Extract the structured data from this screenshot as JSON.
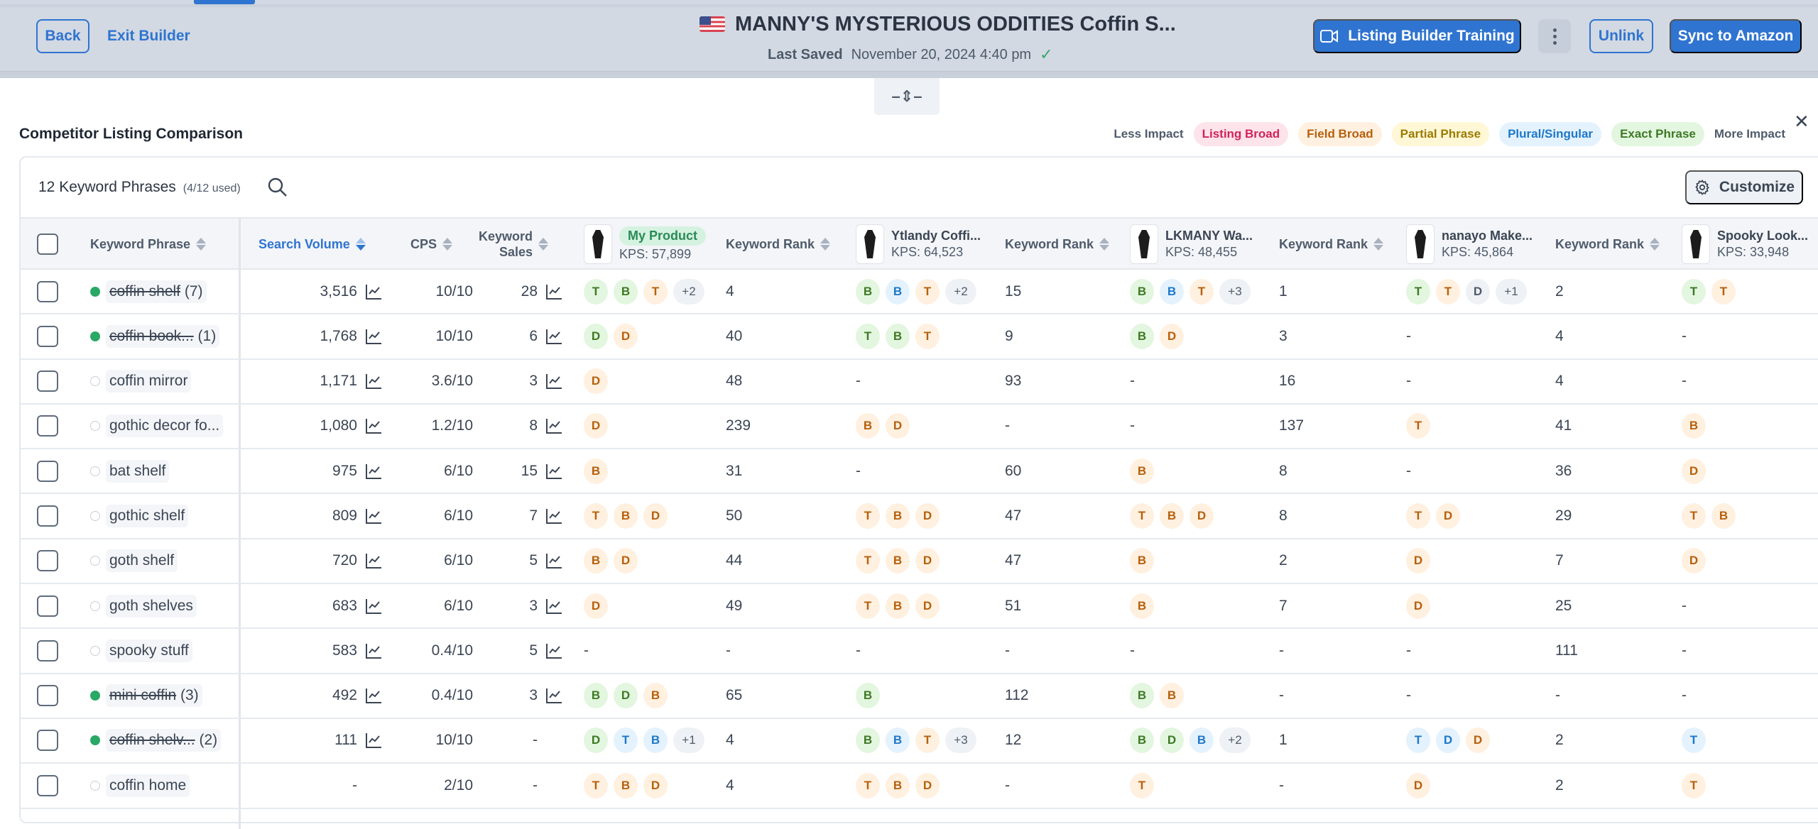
{
  "header": {
    "back_label": "Back",
    "exit_label": "Exit Builder",
    "flag_icon": "us-flag-icon",
    "title": "MANNY'S MYSTERIOUS ODDITIES Coffin S...",
    "last_saved_label": "Last Saved",
    "last_saved_value": "November 20, 2024 4:40 pm",
    "saved_icon": "check-icon",
    "training_label": "Listing Builder Training",
    "training_icon": "video-camera-icon",
    "more_icon": "kebab-menu-icon",
    "unlink_label": "Unlink",
    "sync_label": "Sync to Amazon"
  },
  "drag_handle": {
    "icon": "resize-vertical-icon",
    "glyph": "–⇕–"
  },
  "section": {
    "title": "Competitor Listing Comparison",
    "close_glyph": "✕",
    "legend": {
      "less_label": "Less Impact",
      "more_label": "More Impact",
      "items": [
        {
          "label": "Listing Broad",
          "bg": "#fde3ea",
          "color": "#d0245a"
        },
        {
          "label": "Field Broad",
          "bg": "#fff0e0",
          "color": "#b6600c"
        },
        {
          "label": "Partial Phrase",
          "bg": "#fff7d6",
          "color": "#9a7b00"
        },
        {
          "label": "Plural/Singular",
          "bg": "#e4f2fd",
          "color": "#1d78c9"
        },
        {
          "label": "Exact Phrase",
          "bg": "#e3f6df",
          "color": "#3d7a25"
        }
      ]
    }
  },
  "toolbar": {
    "count_label": "12 Keyword Phrases",
    "used_label": "(4/12 used)",
    "search_icon": "search-icon",
    "customize_label": "Customize",
    "customize_icon": "gear-icon"
  },
  "columns": {
    "keyword": "Keyword Phrase",
    "search_volume": "Search Volume",
    "cps": "CPS",
    "keyword_sales_line1": "Keyword",
    "keyword_sales_line2": "Sales",
    "rank": "Keyword Rank",
    "products": [
      {
        "name": "My Product",
        "kps": "KPS: 57,899",
        "mine": true
      },
      {
        "name": "Ytlandy Coffi...",
        "kps": "KPS: 64,523",
        "mine": false
      },
      {
        "name": "LKMANY Wa...",
        "kps": "KPS: 48,455",
        "mine": false
      },
      {
        "name": "nanayo Make...",
        "kps": "KPS: 45,864",
        "mine": false
      },
      {
        "name": "Spooky Look...",
        "kps": "KPS: 33,948",
        "mine": false
      }
    ]
  },
  "rows": [
    {
      "keyword": "coffin shelf",
      "count": "(7)",
      "used": true,
      "sv": "3,516",
      "sv_trend": true,
      "cps": "10/10",
      "ks": "28",
      "ks_trend": true,
      "products": [
        {
          "badges": [
            [
              "T",
              "exact"
            ],
            [
              "B",
              "exact"
            ],
            [
              "T",
              "field"
            ],
            [
              "+2",
              "more"
            ]
          ],
          "rank": "4"
        },
        {
          "badges": [
            [
              "B",
              "exact"
            ],
            [
              "B",
              "plural"
            ],
            [
              "T",
              "field"
            ],
            [
              "+2",
              "more"
            ]
          ],
          "rank": "15"
        },
        {
          "badges": [
            [
              "B",
              "exact"
            ],
            [
              "B",
              "plural"
            ],
            [
              "T",
              "field"
            ],
            [
              "+3",
              "more"
            ]
          ],
          "rank": "1"
        },
        {
          "badges": [
            [
              "T",
              "exact"
            ],
            [
              "T",
              "field"
            ],
            [
              "D",
              "neutral"
            ],
            [
              "+1",
              "more"
            ]
          ],
          "rank": "2"
        },
        {
          "badges": [
            [
              "T",
              "exact"
            ],
            [
              "T",
              "field"
            ]
          ],
          "rank": null
        }
      ]
    },
    {
      "keyword": "coffin book...",
      "count": "(1)",
      "used": true,
      "sv": "1,768",
      "sv_trend": true,
      "cps": "10/10",
      "ks": "6",
      "ks_trend": true,
      "products": [
        {
          "badges": [
            [
              "D",
              "exact"
            ],
            [
              "D",
              "field"
            ]
          ],
          "rank": "40"
        },
        {
          "badges": [
            [
              "T",
              "exact"
            ],
            [
              "B",
              "exact"
            ],
            [
              "T",
              "field"
            ]
          ],
          "rank": "9"
        },
        {
          "badges": [
            [
              "B",
              "exact"
            ],
            [
              "D",
              "field"
            ]
          ],
          "rank": "3"
        },
        {
          "badges": [],
          "rank": "4"
        },
        {
          "badges": [],
          "rank": null
        }
      ]
    },
    {
      "keyword": "coffin mirror",
      "count": "",
      "used": false,
      "sv": "1,171",
      "sv_trend": true,
      "cps": "3.6/10",
      "ks": "3",
      "ks_trend": true,
      "products": [
        {
          "badges": [
            [
              "D",
              "field"
            ]
          ],
          "rank": "48"
        },
        {
          "badges": [],
          "rank": "93"
        },
        {
          "badges": [],
          "rank": "16"
        },
        {
          "badges": [],
          "rank": "4"
        },
        {
          "badges": [],
          "rank": null
        }
      ]
    },
    {
      "keyword": "gothic decor fo...",
      "count": "",
      "used": false,
      "sv": "1,080",
      "sv_trend": true,
      "cps": "1.2/10",
      "ks": "8",
      "ks_trend": true,
      "products": [
        {
          "badges": [
            [
              "D",
              "field"
            ]
          ],
          "rank": "239"
        },
        {
          "badges": [
            [
              "B",
              "field"
            ],
            [
              "D",
              "field"
            ]
          ],
          "rank": "-"
        },
        {
          "badges": [],
          "rank": "137"
        },
        {
          "badges": [
            [
              "T",
              "field"
            ]
          ],
          "rank": "41"
        },
        {
          "badges": [
            [
              "B",
              "field"
            ]
          ],
          "rank": null
        }
      ]
    },
    {
      "keyword": "bat shelf",
      "count": "",
      "used": false,
      "sv": "975",
      "sv_trend": true,
      "cps": "6/10",
      "ks": "15",
      "ks_trend": true,
      "products": [
        {
          "badges": [
            [
              "B",
              "field"
            ]
          ],
          "rank": "31"
        },
        {
          "badges": [],
          "rank": "60"
        },
        {
          "badges": [
            [
              "B",
              "field"
            ]
          ],
          "rank": "8"
        },
        {
          "badges": [],
          "rank": "36"
        },
        {
          "badges": [
            [
              "D",
              "field"
            ]
          ],
          "rank": null
        }
      ]
    },
    {
      "keyword": "gothic shelf",
      "count": "",
      "used": false,
      "sv": "809",
      "sv_trend": true,
      "cps": "6/10",
      "ks": "7",
      "ks_trend": true,
      "products": [
        {
          "badges": [
            [
              "T",
              "field"
            ],
            [
              "B",
              "field"
            ],
            [
              "D",
              "field"
            ]
          ],
          "rank": "50"
        },
        {
          "badges": [
            [
              "T",
              "field"
            ],
            [
              "B",
              "field"
            ],
            [
              "D",
              "field"
            ]
          ],
          "rank": "47"
        },
        {
          "badges": [
            [
              "T",
              "field"
            ],
            [
              "B",
              "field"
            ],
            [
              "D",
              "field"
            ]
          ],
          "rank": "8"
        },
        {
          "badges": [
            [
              "T",
              "field"
            ],
            [
              "D",
              "field"
            ]
          ],
          "rank": "29"
        },
        {
          "badges": [
            [
              "T",
              "field"
            ],
            [
              "B",
              "field"
            ]
          ],
          "rank": null
        }
      ]
    },
    {
      "keyword": "goth shelf",
      "count": "",
      "used": false,
      "sv": "720",
      "sv_trend": true,
      "cps": "6/10",
      "ks": "5",
      "ks_trend": true,
      "products": [
        {
          "badges": [
            [
              "B",
              "field"
            ],
            [
              "D",
              "field"
            ]
          ],
          "rank": "44"
        },
        {
          "badges": [
            [
              "T",
              "field"
            ],
            [
              "B",
              "field"
            ],
            [
              "D",
              "field"
            ]
          ],
          "rank": "47"
        },
        {
          "badges": [
            [
              "B",
              "field"
            ]
          ],
          "rank": "2"
        },
        {
          "badges": [
            [
              "D",
              "field"
            ]
          ],
          "rank": "7"
        },
        {
          "badges": [
            [
              "D",
              "field"
            ]
          ],
          "rank": null
        }
      ]
    },
    {
      "keyword": "goth shelves",
      "count": "",
      "used": false,
      "sv": "683",
      "sv_trend": true,
      "cps": "6/10",
      "ks": "3",
      "ks_trend": true,
      "products": [
        {
          "badges": [
            [
              "D",
              "field"
            ]
          ],
          "rank": "49"
        },
        {
          "badges": [
            [
              "T",
              "field"
            ],
            [
              "B",
              "field"
            ],
            [
              "D",
              "field"
            ]
          ],
          "rank": "51"
        },
        {
          "badges": [
            [
              "B",
              "field"
            ]
          ],
          "rank": "7"
        },
        {
          "badges": [
            [
              "D",
              "field"
            ]
          ],
          "rank": "25"
        },
        {
          "badges": [],
          "rank": null
        }
      ]
    },
    {
      "keyword": "spooky stuff",
      "count": "",
      "used": false,
      "sv": "583",
      "sv_trend": true,
      "cps": "0.4/10",
      "ks": "5",
      "ks_trend": true,
      "products": [
        {
          "badges": [],
          "rank": "-"
        },
        {
          "badges": [],
          "rank": "-"
        },
        {
          "badges": [],
          "rank": "-"
        },
        {
          "badges": [],
          "rank": "111"
        },
        {
          "badges": [],
          "rank": null
        }
      ]
    },
    {
      "keyword": "mini coffin",
      "count": "(3)",
      "used": true,
      "sv": "492",
      "sv_trend": true,
      "cps": "0.4/10",
      "ks": "3",
      "ks_trend": true,
      "products": [
        {
          "badges": [
            [
              "B",
              "exact"
            ],
            [
              "D",
              "exact"
            ],
            [
              "B",
              "field"
            ]
          ],
          "rank": "65"
        },
        {
          "badges": [
            [
              "B",
              "exact"
            ]
          ],
          "rank": "112"
        },
        {
          "badges": [
            [
              "B",
              "exact"
            ],
            [
              "B",
              "field"
            ]
          ],
          "rank": "-"
        },
        {
          "badges": [],
          "rank": "-"
        },
        {
          "badges": [],
          "rank": null
        }
      ]
    },
    {
      "keyword": "coffin shelv...",
      "count": "(2)",
      "used": true,
      "sv": "111",
      "sv_trend": true,
      "cps": "10/10",
      "ks": "-",
      "ks_trend": false,
      "products": [
        {
          "badges": [
            [
              "D",
              "exact"
            ],
            [
              "T",
              "plural"
            ],
            [
              "B",
              "plural"
            ],
            [
              "+1",
              "more"
            ]
          ],
          "rank": "4"
        },
        {
          "badges": [
            [
              "B",
              "exact"
            ],
            [
              "B",
              "plural"
            ],
            [
              "T",
              "field"
            ],
            [
              "+3",
              "more"
            ]
          ],
          "rank": "12"
        },
        {
          "badges": [
            [
              "B",
              "exact"
            ],
            [
              "D",
              "exact"
            ],
            [
              "B",
              "plural"
            ],
            [
              "+2",
              "more"
            ]
          ],
          "rank": "1"
        },
        {
          "badges": [
            [
              "T",
              "plural"
            ],
            [
              "D",
              "plural"
            ],
            [
              "D",
              "field"
            ]
          ],
          "rank": "2"
        },
        {
          "badges": [
            [
              "T",
              "plural"
            ]
          ],
          "rank": null
        }
      ]
    },
    {
      "keyword": "coffin home",
      "count": "",
      "used": false,
      "sv": "-",
      "sv_trend": false,
      "cps": "2/10",
      "ks": "-",
      "ks_trend": false,
      "products": [
        {
          "badges": [
            [
              "T",
              "field"
            ],
            [
              "B",
              "field"
            ],
            [
              "D",
              "field"
            ]
          ],
          "rank": "4"
        },
        {
          "badges": [
            [
              "T",
              "field"
            ],
            [
              "B",
              "field"
            ],
            [
              "D",
              "field"
            ]
          ],
          "rank": "-"
        },
        {
          "badges": [
            [
              "T",
              "field"
            ]
          ],
          "rank": "-"
        },
        {
          "badges": [
            [
              "D",
              "field"
            ]
          ],
          "rank": "2"
        },
        {
          "badges": [
            [
              "T",
              "field"
            ]
          ],
          "rank": null
        }
      ]
    }
  ],
  "empty_value": "-",
  "colors": {
    "accent": "#2f74d0",
    "used_dot": "#2aa865",
    "mine_badge_bg": "#d5f2e1",
    "mine_badge_text": "#2a8a55"
  }
}
